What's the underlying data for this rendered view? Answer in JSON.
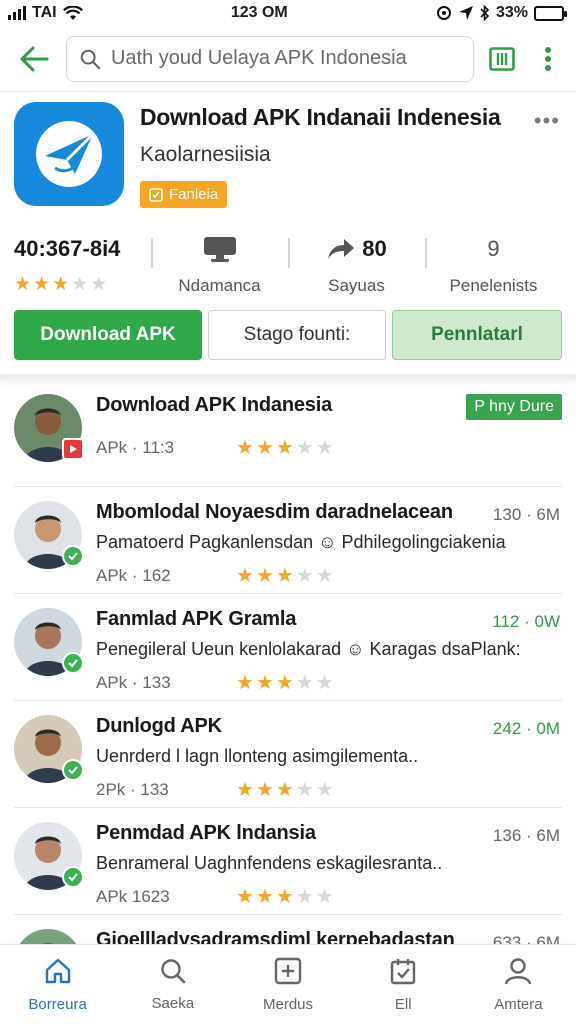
{
  "status_bar": {
    "carrier": "TAI",
    "time": "123 OM",
    "battery_percent": "33%",
    "battery_level": 0.33
  },
  "appbar": {
    "search_placeholder": "Uath youd Uelaya APK Indonesia"
  },
  "app": {
    "title": "Download APK Indanaii Indenesia",
    "developer": "Kaolarnesiisia",
    "badge": "Fanleia",
    "more": "•••",
    "stats": [
      {
        "value": "40:367-8i4",
        "rating": 3,
        "label": ""
      },
      {
        "value": "",
        "label": "Ndamanca",
        "icon": "monitor-icon"
      },
      {
        "value": "80",
        "label": "Sayuas",
        "icon": "share-arrow-icon"
      },
      {
        "value": "9",
        "label": "Penelenists"
      }
    ],
    "actions": {
      "primary": "Download APK",
      "secondary": "Stago founti:",
      "tertiary": "Pennlatarl"
    }
  },
  "list": [
    {
      "title": "Download APK Indanesia",
      "desc": "",
      "sub": "APk · 11:3",
      "size": "",
      "chip": "P hny Dure",
      "rating": 3,
      "badge": "red",
      "skin": "#8a5a3c",
      "bg": "#6b8a6a"
    },
    {
      "title": "Mbomlodal Noyaesdim daradnelacean",
      "desc": "Pamatoerd Pagkanlensdan ☺ Pdhilegolingciakenia",
      "sub": "APk · 162",
      "size": "130 · 6M",
      "chip": "",
      "rating": 3,
      "badge": "green",
      "skin": "#c99870",
      "bg": "#dfe3e8"
    },
    {
      "title": "Fanmlad APK Gramla",
      "desc": "Penegileral Ueun kenlolakarad ☺ Karagas dsaPlank:",
      "sub": "APk · 133",
      "size": "112 · 0W",
      "chip": "",
      "rating": 3,
      "badge": "green",
      "skin": "#a8765a",
      "bg": "#cfd7df"
    },
    {
      "title": "Dunlogd APK",
      "desc": "Uenrderd l lagn llonteng asimgilementa..",
      "sub": "2Pk · 133",
      "size": "242 · 0M",
      "chip": "",
      "rating": 3,
      "badge": "green",
      "skin": "#9c6b4c",
      "bg": "#d7c9b8"
    },
    {
      "title": "Penmdad APK lndansia",
      "desc": "Benrameral Uaghnfendens eskagilesranta..",
      "sub": "APk 1623",
      "size": "136 · 6M",
      "chip": "",
      "rating": 3,
      "badge": "green",
      "skin": "#b8866a",
      "bg": "#e2e5ea"
    },
    {
      "title": "Gioellladysadramsdiml kerpebadastan",
      "desc": "",
      "sub": "",
      "size": "633 · 6M",
      "chip": "",
      "rating": 0,
      "badge": "",
      "skin": "#c4a58c",
      "bg": "#7aa27e"
    }
  ],
  "list_size_green": [
    false,
    false,
    true,
    true,
    false,
    false
  ],
  "bottom_nav": [
    {
      "label": "Borreura",
      "icon": "home-icon",
      "active": true
    },
    {
      "label": "Saeka",
      "icon": "search-icon",
      "active": false
    },
    {
      "label": "Merdus",
      "icon": "plus-box-icon",
      "active": false
    },
    {
      "label": "Ell",
      "icon": "calendar-check-icon",
      "active": false
    },
    {
      "label": "Amtera",
      "icon": "person-icon",
      "active": false
    }
  ],
  "colors": {
    "accent": "#2fa84a",
    "brand_blue": "#1689dd",
    "badge_orange": "#f6a623",
    "star": "#f5a623",
    "nav_active": "#1f78c1"
  }
}
